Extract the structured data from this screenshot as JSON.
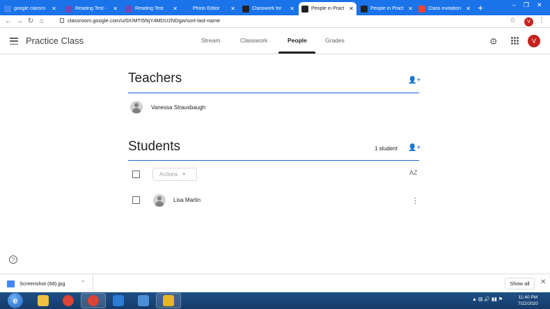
{
  "browser": {
    "tabs": [
      {
        "label": "google classro",
        "icon": "google-docs-icon",
        "color": "#4285f4",
        "active": false
      },
      {
        "label": "Reading Test -",
        "icon": "forms-icon",
        "color": "#7248b9",
        "active": false
      },
      {
        "label": "Reading Test",
        "icon": "forms-icon",
        "color": "#7248b9",
        "active": false
      },
      {
        "label": "Photo Editor",
        "icon": "photo-editor-icon",
        "color": "#1a73e8",
        "active": false
      },
      {
        "label": "Classwork for",
        "icon": "classroom-icon",
        "color": "#202124",
        "active": false
      },
      {
        "label": "People in Pract",
        "icon": "classroom-icon",
        "color": "#202124",
        "active": true
      },
      {
        "label": "People in Pract",
        "icon": "classroom-icon",
        "color": "#202124",
        "active": false
      },
      {
        "label": "Class invitation",
        "icon": "gmail-icon",
        "color": "#ea4335",
        "active": false
      }
    ],
    "new_tab": "+",
    "url": "classroom.google.com/u/0/r/MTI5NjY4MDU2NDgw/sort-last-name",
    "profile_initial": "V"
  },
  "appbar": {
    "class_name": "Practice Class",
    "tabs": [
      {
        "label": "Stream",
        "active": false
      },
      {
        "label": "Classwork",
        "active": false
      },
      {
        "label": "People",
        "active": true
      },
      {
        "label": "Grades",
        "active": false
      }
    ],
    "profile_initial": "V"
  },
  "teachers": {
    "title": "Teachers",
    "people": [
      {
        "name": "Vanessa Strausbaugh"
      }
    ]
  },
  "students": {
    "title": "Students",
    "count": "1 student",
    "actions_label": "Actions",
    "sort_label": "AZ",
    "people": [
      {
        "name": "Lisa Martin"
      }
    ]
  },
  "downloads": {
    "file_name": "Screenshot (68).jpg",
    "show_all": "Show all"
  },
  "taskbar": {
    "apps": [
      {
        "name": "file-explorer-icon",
        "color": "#f0c040"
      },
      {
        "name": "chrome-icon",
        "color": "#db4437"
      },
      {
        "name": "chrome-icon",
        "color": "#db4437"
      },
      {
        "name": "media-player-icon",
        "color": "#2a7bd6"
      },
      {
        "name": "display-icon",
        "color": "#4a90d9"
      },
      {
        "name": "photo-app-icon",
        "color": "#e8b820"
      }
    ],
    "time": "11:40 PM",
    "date": "7/22/2020"
  }
}
